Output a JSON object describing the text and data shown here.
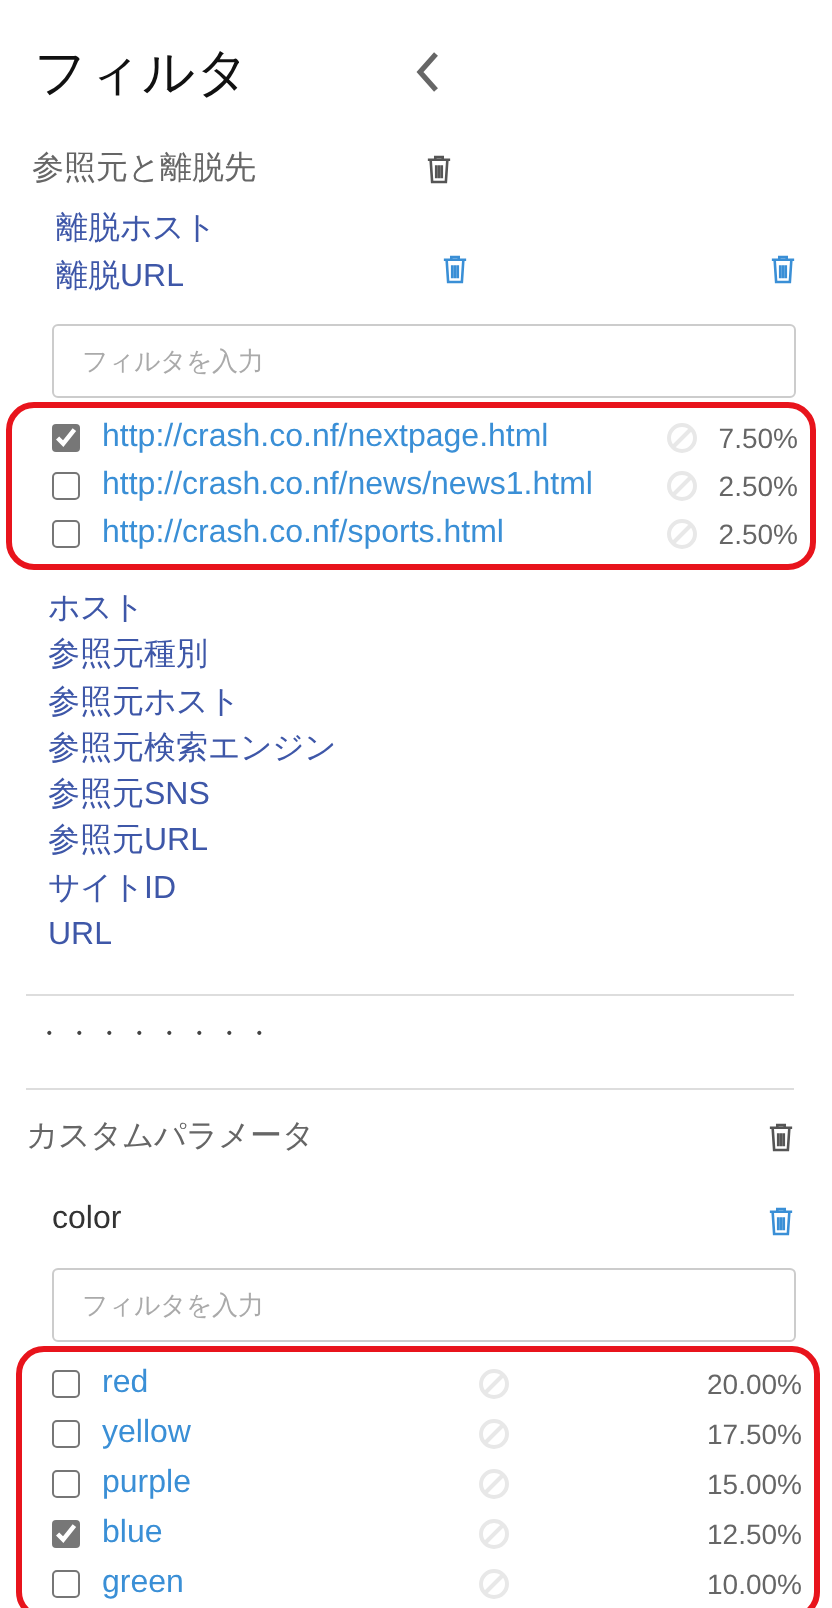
{
  "title": "フィルタ",
  "section1": {
    "label": "参照元と離脱先",
    "fields": [
      "離脱ホスト",
      "離脱URL"
    ],
    "filter": {
      "placeholder": "フィルタを入力"
    },
    "values": [
      {
        "label": "http://crash.co.nf/nextpage.html",
        "checked": true,
        "percent": "7.50%"
      },
      {
        "label": "http://crash.co.nf/news/news1.html",
        "checked": false,
        "percent": "2.50%"
      },
      {
        "label": "http://crash.co.nf/sports.html",
        "checked": false,
        "percent": "2.50%"
      }
    ],
    "options": [
      "ホスト",
      "参照元種別",
      "参照元ホスト",
      "参照元検索エンジン",
      "参照元SNS",
      "参照元URL",
      "サイトID",
      "URL"
    ]
  },
  "dots": "・・・・・・・・",
  "section2": {
    "label": "カスタムパラメータ",
    "field": "color",
    "filter": {
      "placeholder": "フィルタを入力"
    },
    "values": [
      {
        "label": "red",
        "checked": false,
        "percent": "20.00%"
      },
      {
        "label": "yellow",
        "checked": false,
        "percent": "17.50%"
      },
      {
        "label": "purple",
        "checked": false,
        "percent": "15.00%"
      },
      {
        "label": "blue",
        "checked": true,
        "percent": "12.50%"
      },
      {
        "label": "green",
        "checked": false,
        "percent": "10.00%"
      }
    ]
  }
}
